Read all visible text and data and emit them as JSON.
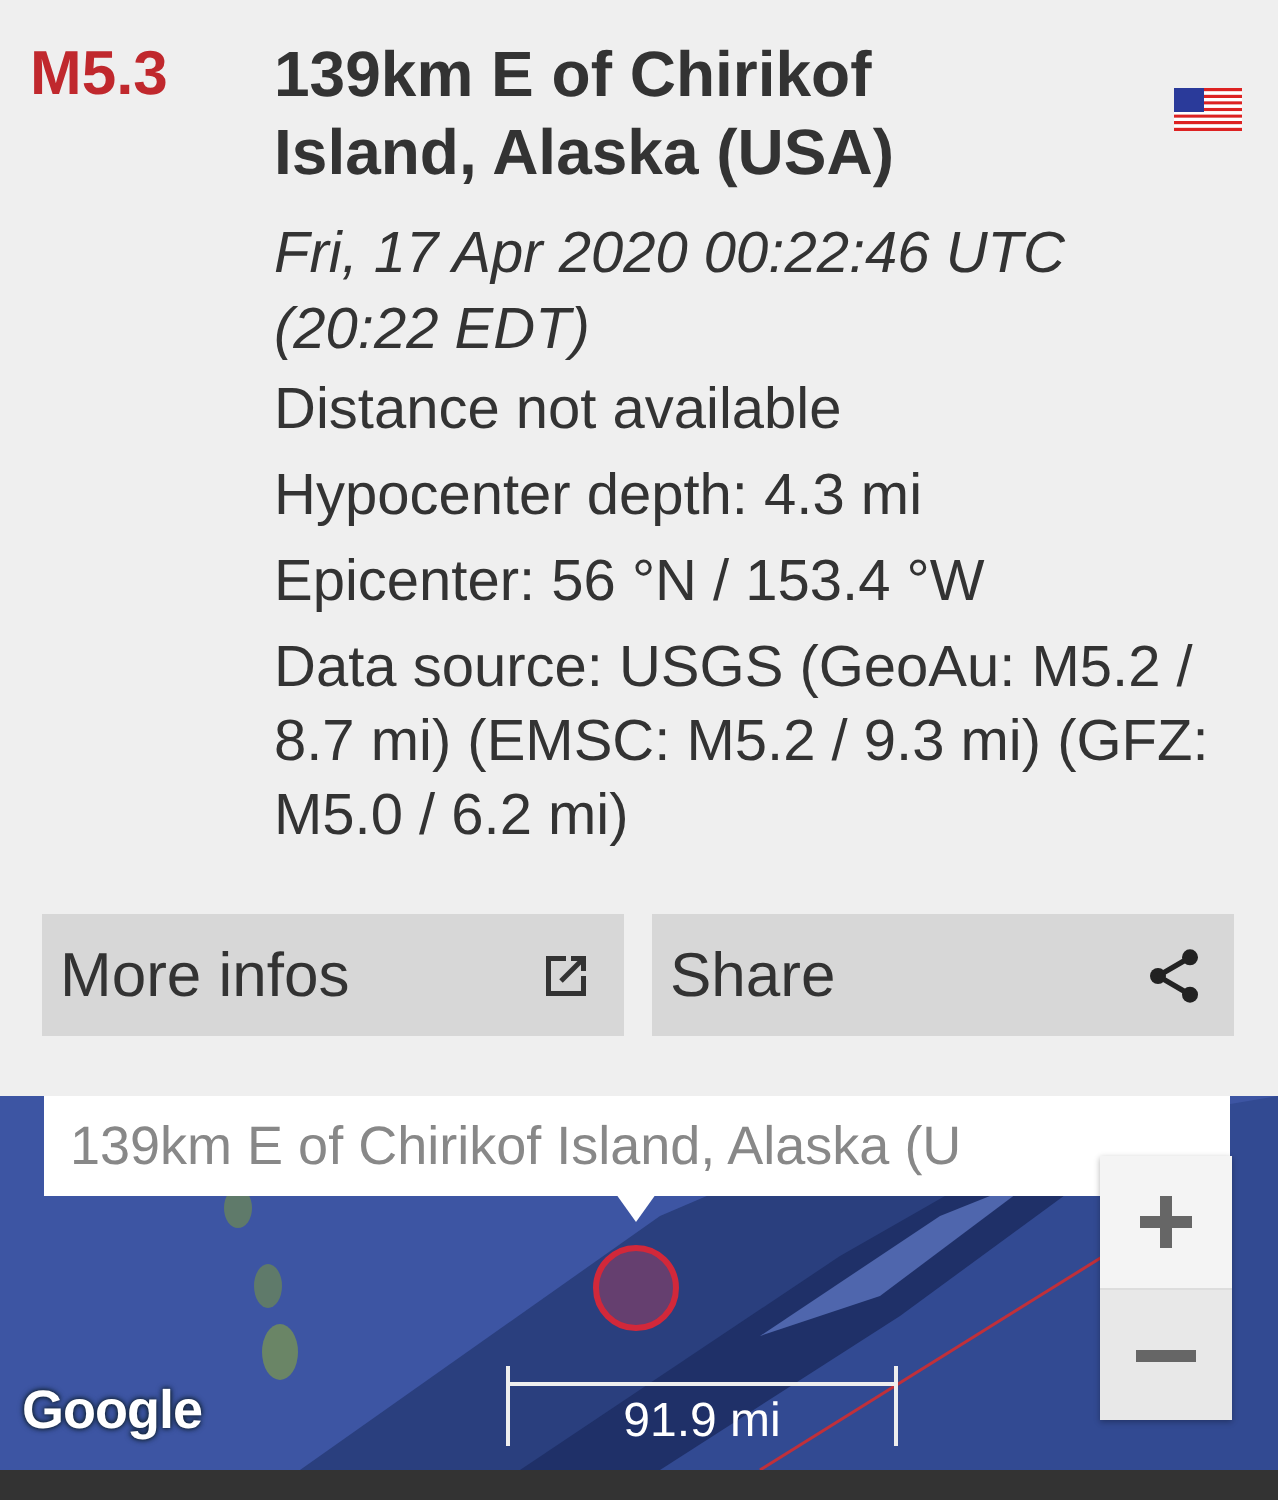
{
  "event": {
    "magnitude": "M5.3",
    "title": "139km E of Chirikof Island, Alaska (USA)",
    "time": "Fri, 17 Apr 2020 00:22:46 UTC (20:22 EDT)",
    "details": [
      "Distance not available",
      "Hypocenter depth: 4.3 mi",
      "Epicenter: 56 °N / 153.4 °W",
      "Data source: USGS (GeoAu: M5.2 / 8.7 mi) (EMSC: M5.2 / 9.3 mi) (GFZ: M5.0 / 6.2 mi)"
    ]
  },
  "actions": [
    {
      "label": "More infos",
      "kind": "external"
    },
    {
      "label": "Share",
      "kind": "share"
    }
  ],
  "map": {
    "info_window": "139km E of Chirikof Island, Alaska (U",
    "logo": "Google",
    "scale": "91.9 mi"
  }
}
